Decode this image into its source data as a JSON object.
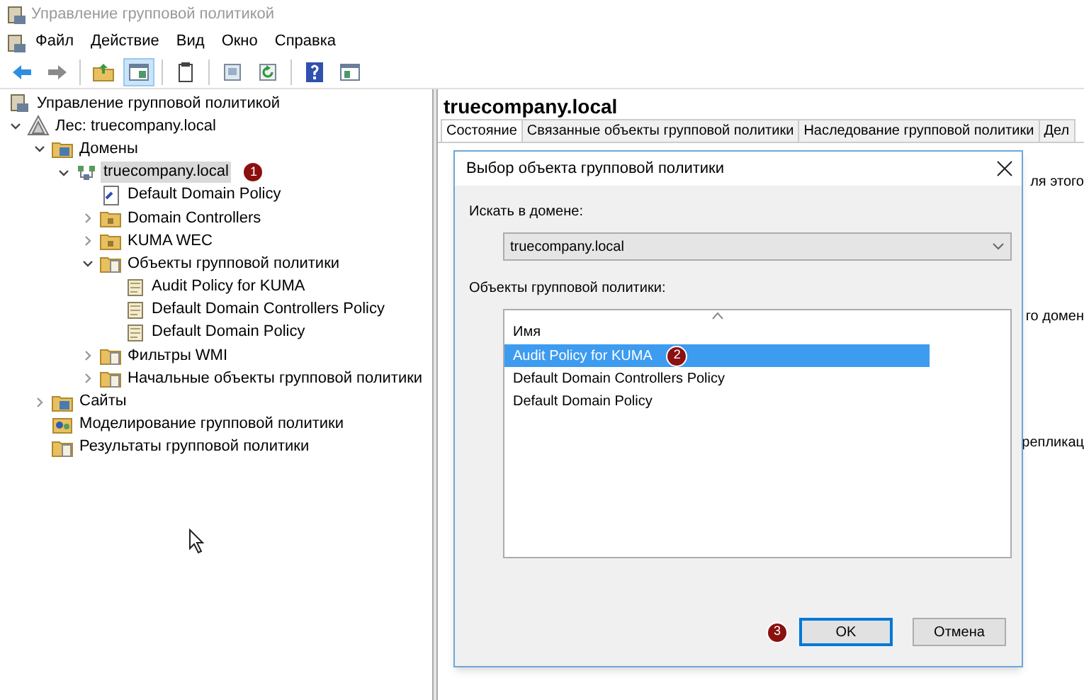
{
  "window": {
    "title": "Управление групповой политикой"
  },
  "menu": [
    "Файл",
    "Действие",
    "Вид",
    "Окно",
    "Справка"
  ],
  "toolbar": [
    {
      "kind": "back"
    },
    {
      "kind": "forward"
    },
    {
      "kind": "sep"
    },
    {
      "kind": "folder-up"
    },
    {
      "kind": "pane",
      "selected": true
    },
    {
      "kind": "sep"
    },
    {
      "kind": "clipboard"
    },
    {
      "kind": "sep"
    },
    {
      "kind": "export"
    },
    {
      "kind": "refresh"
    },
    {
      "kind": "sep"
    },
    {
      "kind": "help"
    },
    {
      "kind": "pane2"
    }
  ],
  "tree": [
    {
      "label": "Управление групповой политикой",
      "kind": "console",
      "selected": false,
      "children": [
        {
          "label": "Лес: truecompany.local",
          "kind": "forest",
          "selected": false,
          "expanded": true,
          "children": [
            {
              "label": "Домены",
              "kind": "domains",
              "selected": false,
              "expanded": true,
              "children": [
                {
                  "label": "truecompany.local",
                  "kind": "domain",
                  "selected": true,
                  "expanded": true,
                  "callout": "1",
                  "children": [
                    {
                      "label": "Default Domain Policy",
                      "kind": "link",
                      "selected": false
                    },
                    {
                      "label": "Domain Controllers",
                      "kind": "ou",
                      "selected": false,
                      "expanded": false
                    },
                    {
                      "label": "KUMA WEC",
                      "kind": "ou",
                      "selected": false,
                      "expanded": false
                    },
                    {
                      "label": "Объекты групповой политики",
                      "kind": "gpo-folder",
                      "selected": false,
                      "expanded": true,
                      "children": [
                        {
                          "label": "Audit Policy for KUMA",
                          "kind": "gpo",
                          "selected": false
                        },
                        {
                          "label": "Default Domain Controllers Policy",
                          "kind": "gpo",
                          "selected": false
                        },
                        {
                          "label": "Default Domain Policy",
                          "kind": "gpo",
                          "selected": false
                        }
                      ]
                    },
                    {
                      "label": "Фильтры WMI",
                      "kind": "gpo-folder",
                      "selected": false,
                      "expanded": false
                    },
                    {
                      "label": "Начальные объекты групповой политики",
                      "kind": "gpo-folder",
                      "selected": false,
                      "expanded": false
                    }
                  ]
                }
              ]
            },
            {
              "label": "Сайты",
              "kind": "domains",
              "selected": false,
              "expanded": false
            },
            {
              "label": "Моделирование групповой политики",
              "kind": "modeling",
              "selected": false
            },
            {
              "label": "Результаты групповой политики",
              "kind": "gpo-folder",
              "selected": false
            }
          ]
        }
      ]
    }
  ],
  "details": {
    "title": "truecompany.local",
    "tabs": [
      {
        "label": "Состояние",
        "selected": true
      },
      {
        "label": "Связанные объекты групповой политики",
        "selected": false
      },
      {
        "label": "Наследование групповой политики",
        "selected": false
      },
      {
        "label": "Дел",
        "selected": false
      }
    ],
    "hidden_text": [
      "ля этого",
      "го домен",
      "репликац"
    ]
  },
  "dialog": {
    "title": "Выбор объекта групповой политики",
    "domain_label": "Искать в домене:",
    "domain_value": "truecompany.local",
    "list_label": "Объекты групповой политики:",
    "column": "Имя",
    "rows": [
      {
        "name": "Audit Policy for KUMA",
        "selected": true,
        "callout": "2"
      },
      {
        "name": "Default Domain Controllers Policy",
        "selected": false
      },
      {
        "name": "Default Domain Policy",
        "selected": false
      }
    ],
    "buttons": [
      {
        "label": "OK",
        "default": true,
        "callout": "3"
      },
      {
        "label": "Отмена",
        "default": false
      }
    ]
  }
}
